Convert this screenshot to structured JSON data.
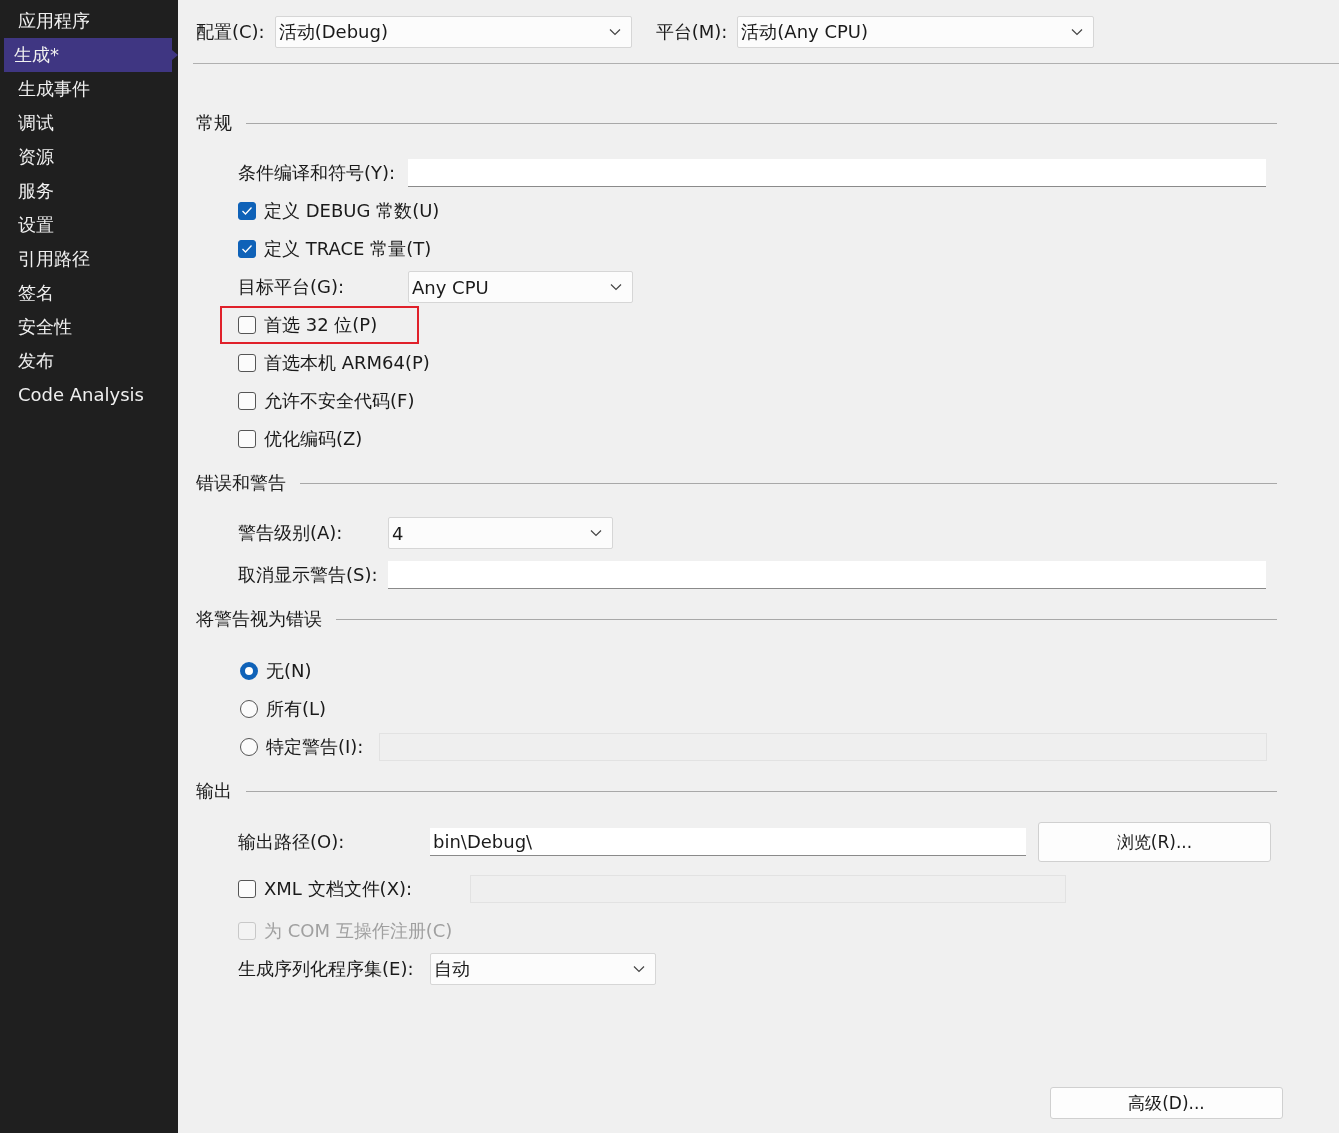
{
  "sidebar": {
    "items": [
      {
        "label": "应用程序",
        "selected": false
      },
      {
        "label": "生成*",
        "selected": true
      },
      {
        "label": "生成事件",
        "selected": false
      },
      {
        "label": "调试",
        "selected": false
      },
      {
        "label": "资源",
        "selected": false
      },
      {
        "label": "服务",
        "selected": false
      },
      {
        "label": "设置",
        "selected": false
      },
      {
        "label": "引用路径",
        "selected": false
      },
      {
        "label": "签名",
        "selected": false
      },
      {
        "label": "安全性",
        "selected": false
      },
      {
        "label": "发布",
        "selected": false
      },
      {
        "label": "Code Analysis",
        "selected": false
      }
    ]
  },
  "toolbar": [
    {
      "label": "配置(C):",
      "value": "活动(Debug)"
    },
    {
      "label": "平台(M):",
      "value": "活动(Any CPU)"
    }
  ],
  "sections": [
    {
      "title": "常规",
      "rows": [
        {
          "kind": "text",
          "label": "条件编译和符号(Y):"
        },
        {
          "kind": "checkbox",
          "label": "定义 DEBUG 常数(U)",
          "checked": true,
          "disabled": false,
          "highlighted": false
        },
        {
          "kind": "checkbox",
          "label": "定义 TRACE 常量(T)",
          "checked": true,
          "disabled": false,
          "highlighted": false
        },
        {
          "kind": "dropdown",
          "label": "目标平台(G):",
          "value": "Any CPU"
        },
        {
          "kind": "checkbox",
          "label": "首选 32 位(P)",
          "checked": false,
          "disabled": false,
          "highlighted": true
        },
        {
          "kind": "checkbox",
          "label": "首选本机 ARM64(P)",
          "checked": false,
          "disabled": false,
          "highlighted": false
        },
        {
          "kind": "checkbox",
          "label": "允许不安全代码(F)",
          "checked": false,
          "disabled": false,
          "highlighted": false
        },
        {
          "kind": "checkbox",
          "label": "优化编码(Z)",
          "checked": false,
          "disabled": false,
          "highlighted": false
        }
      ]
    },
    {
      "title": "错误和警告",
      "rows": [
        {
          "kind": "dropdown",
          "label": "警告级别(A):",
          "value": "4"
        },
        {
          "kind": "text",
          "label": "取消显示警告(S):"
        }
      ]
    },
    {
      "title": "将警告视为错误",
      "rows": [
        {
          "kind": "radio",
          "label": "无(N)",
          "selected": true
        },
        {
          "kind": "radio",
          "label": "所有(L)",
          "selected": false
        },
        {
          "kind": "radio",
          "label": "特定警告(I):",
          "selected": false,
          "field": {
            "disabled": true
          }
        }
      ]
    },
    {
      "title": "输出",
      "rows": [
        {
          "kind": "path",
          "label": "输出路径(O):",
          "value": "bin\\Debug\\",
          "button": "浏览(R)..."
        },
        {
          "kind": "checkbox",
          "label": "XML 文档文件(X):",
          "checked": false,
          "disabled": false,
          "highlighted": false,
          "field": {
            "disabled": true
          }
        },
        {
          "kind": "checkbox",
          "label": "为 COM 互操作注册(C)",
          "checked": false,
          "disabled": true,
          "highlighted": false
        },
        {
          "kind": "dropdown",
          "label": "生成序列化程序集(E):",
          "value": "自动"
        }
      ]
    }
  ],
  "footer_button": "高级(D)..."
}
